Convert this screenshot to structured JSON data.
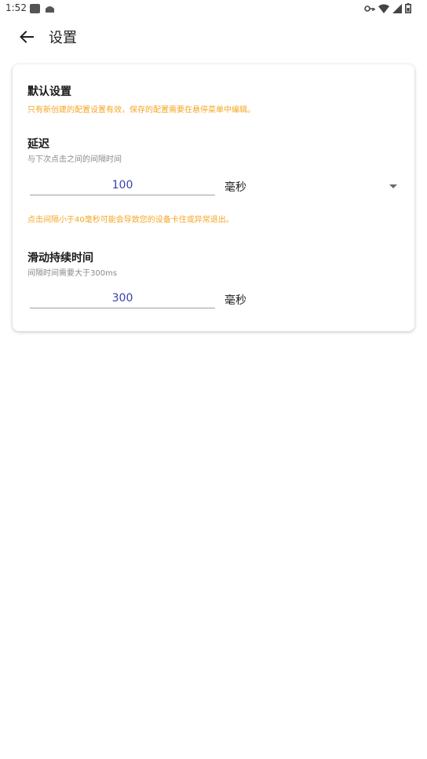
{
  "status": {
    "time": "1:52",
    "left_icons": [
      "notification-icon",
      "android-icon"
    ],
    "right_icons": [
      "vpn-key-icon",
      "wifi-icon",
      "signal-icon",
      "battery-icon"
    ]
  },
  "toolbar": {
    "title": "设置",
    "back_icon": "arrow-left-icon"
  },
  "card": {
    "default_section": {
      "title": "默认设置",
      "hint": "只有新创建的配置设置有效，保存的配置需要在悬停菜单中编辑。"
    },
    "delay_section": {
      "title": "延迟",
      "subtitle": "与下次点击之间的间隔时间",
      "value": "100",
      "unit": "毫秒",
      "warning": "点击间隔小于40毫秒可能会导致您的设备卡住或异常退出。"
    },
    "swipe_section": {
      "title": "滑动持续时间",
      "subtitle": "间隔时间需要大于300ms",
      "value": "300",
      "unit": "毫秒"
    }
  },
  "colors": {
    "accent_text": "#3a3fb0",
    "warning_text": "#f5a623",
    "hint_text": "#8a8a8a"
  }
}
